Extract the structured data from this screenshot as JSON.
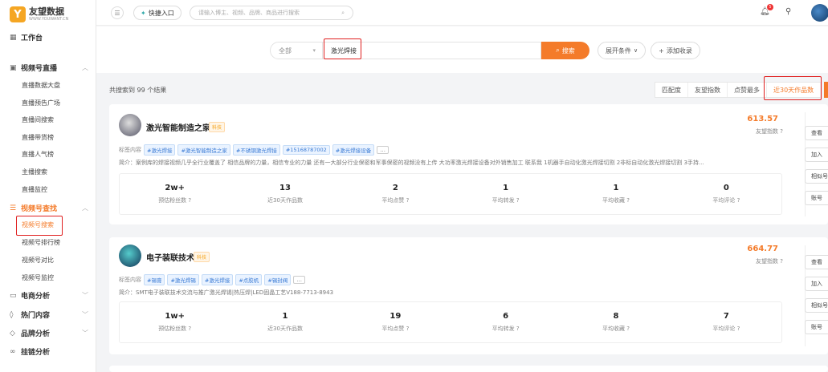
{
  "brand": {
    "name": "友望数据",
    "sub": "WWW.YOUWANT.CN",
    "mark": "Y"
  },
  "sidebar": {
    "workbench": "工作台",
    "live_group": "视频号直播",
    "live_items": [
      "直播数据大盘",
      "直播预告广场",
      "直播间搜索",
      "直播带货榜",
      "直播人气榜",
      "主播搜索",
      "直播监控"
    ],
    "search_group": "视频号查找",
    "search_items": [
      "视频号搜索",
      "视频号排行榜",
      "视频号对比",
      "视频号监控"
    ],
    "ecom": "电商分析",
    "hot": "热门内容",
    "brand_analysis": "品牌分析",
    "hashtag": "挂链分析"
  },
  "topbar": {
    "quick_entry": "快捷入口",
    "search_placeholder": "请输入博主、视频、品牌、商品进行搜索",
    "notification_count": "5"
  },
  "search": {
    "scope": "全部",
    "query": "激光焊接",
    "button": "搜索",
    "expand": "展开条件",
    "add_favorite": "添加收录"
  },
  "results": {
    "count_text": "共搜索到 99 个结果",
    "sort_tabs": [
      "匹配度",
      "友望指数",
      "点赞最多",
      "近30天作品数"
    ]
  },
  "cards": [
    {
      "name": "激光智能制造之家",
      "category": "科技",
      "score": "613.57",
      "score_label": "友望指数",
      "tags_label": "标签内容",
      "tags": [
        "#激光焊接",
        "#激光智能制造之家",
        "#不锈钢激光焊接",
        "#15168787002",
        "#激光焊接设备"
      ],
      "intro": "简介：案例库的焊接视频几乎全行业覆盖了 相信品牌的力量，相信专业的力量 还有一大部分行业保密和军事保密的视频没有上传 大功率激光焊接设备对外销售加工 联系我 1机器手自动化激光焊接切割 2非标自动化激光焊接切割 3手持...",
      "stats": [
        {
          "value": "2w+",
          "label": "预估粉丝数"
        },
        {
          "value": "13",
          "label": "近30天作品数"
        },
        {
          "value": "2",
          "label": "平均点赞"
        },
        {
          "value": "1",
          "label": "平均转发"
        },
        {
          "value": "1",
          "label": "平均收藏"
        },
        {
          "value": "0",
          "label": "平均评论"
        }
      ],
      "actions": [
        "查看",
        "加入",
        "相似号",
        "账号"
      ]
    },
    {
      "name": "电子装联技术",
      "category": "科技",
      "score": "664.77",
      "score_label": "友望指数",
      "tags_label": "标签内容",
      "tags": [
        "#锡膏",
        "#激光焊锡",
        "#激光焊接",
        "#点胶机",
        "#锡封阀"
      ],
      "intro": "简介：SMT电子装联技术交流与推广激光焊锡|热压焊|LED固晶工艺V188-7713-8943",
      "stats": [
        {
          "value": "1w+",
          "label": "预估粉丝数"
        },
        {
          "value": "1",
          "label": "近30天作品数"
        },
        {
          "value": "19",
          "label": "平均点赞"
        },
        {
          "value": "6",
          "label": "平均转发"
        },
        {
          "value": "8",
          "label": "平均收藏"
        },
        {
          "value": "7",
          "label": "平均评论"
        }
      ],
      "actions": [
        "查看",
        "加入",
        "相似号",
        "账号"
      ]
    }
  ]
}
